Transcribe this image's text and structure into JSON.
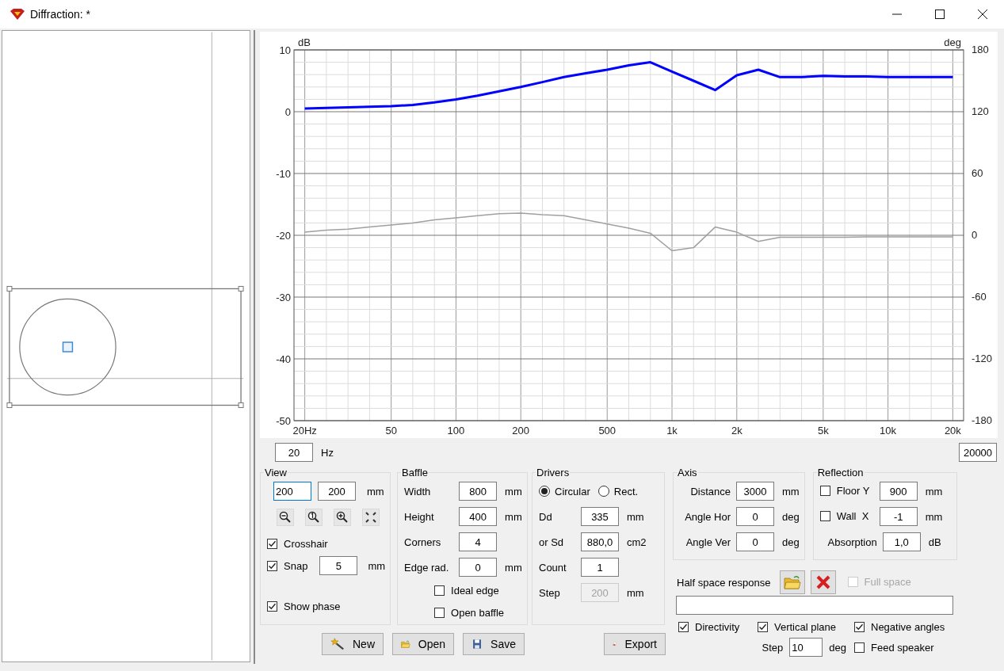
{
  "window": {
    "title": "Diffraction: *"
  },
  "chart": {
    "chart_data": {
      "type": "line",
      "categories": [
        "20Hz",
        null,
        null,
        null,
        "50",
        null,
        null,
        "100",
        null,
        null,
        "200",
        null,
        null,
        null,
        "500",
        null,
        null,
        "1k",
        null,
        null,
        "2k",
        null,
        null,
        null,
        "5k",
        null,
        null,
        "10k",
        null,
        null,
        "20k"
      ],
      "ylim": [
        -50,
        10
      ],
      "grid": true,
      "ylabel": "dB",
      "y2label": "deg",
      "y2lim": [
        -180,
        180
      ],
      "yticks": [
        10,
        0,
        -10,
        -20,
        -30,
        -40,
        -50
      ],
      "y2ticks": [
        180,
        120,
        60,
        0,
        -60,
        -120,
        -180
      ],
      "series": [
        {
          "color": "#0000ff",
          "values": [
            0.5,
            0.6,
            0.7,
            0.8,
            0.9,
            1.1,
            1.5,
            2.0,
            2.6,
            3.3,
            4.0,
            4.8,
            5.6,
            6.2,
            6.8,
            7.5,
            8.0,
            6.5,
            5.0,
            3.5,
            5.9,
            6.8,
            5.6,
            5.6,
            5.8,
            5.7,
            5.7,
            5.6,
            5.6,
            5.6,
            5.6
          ]
        },
        {
          "color": "#a0a0a0",
          "axis": "y2",
          "values": [
            3,
            5,
            6,
            8,
            10,
            12,
            15,
            17,
            19,
            21,
            21.5,
            20,
            19,
            15,
            11,
            7,
            2,
            -15,
            -12,
            8,
            3,
            -6,
            -2,
            -2,
            -2,
            -2,
            -1.5,
            -1.5,
            -1.5,
            -1.5,
            -1.5
          ]
        }
      ]
    }
  },
  "freq_range": {
    "min": "20",
    "unit": "Hz",
    "max": "20000"
  },
  "view": {
    "title": "View",
    "fields": [
      {
        "value": "200",
        "focused": true
      },
      {
        "value": "200",
        "focused": false
      }
    ],
    "unit": "mm",
    "crosshair": {
      "label": "Crosshair",
      "checked": true
    },
    "snap": {
      "label": "Snap",
      "checked": true,
      "value": "5",
      "unit": "mm"
    },
    "show_phase": {
      "label": "Show phase",
      "checked": true
    }
  },
  "baffle": {
    "title": "Baffle",
    "fields": [
      {
        "label": "Width",
        "value": "800",
        "unit": "mm"
      },
      {
        "label": "Height",
        "value": "400",
        "unit": "mm"
      },
      {
        "label": "Corners",
        "value": "4"
      },
      {
        "label": "Edge rad.",
        "value": "0",
        "unit": "mm"
      }
    ],
    "checks": [
      {
        "label": "Ideal edge",
        "checked": false
      },
      {
        "label": "Open baffle",
        "checked": false
      }
    ]
  },
  "file_buttons": [
    {
      "label": "New",
      "kind": "new"
    },
    {
      "label": "Open",
      "kind": "open"
    },
    {
      "label": "Save",
      "kind": "save"
    }
  ],
  "drivers": {
    "title": "Drivers",
    "shapes": [
      {
        "label": "Circular",
        "selected": true
      },
      {
        "label": "Rect.",
        "selected": false
      }
    ],
    "fields": [
      {
        "label": "Dd",
        "value": "335",
        "unit": "mm",
        "disabled": false
      },
      {
        "label": "or Sd",
        "value": "880,0",
        "unit": "cm2",
        "disabled": false
      },
      {
        "label": "Count",
        "value": "1",
        "disabled": false
      },
      {
        "label": "Step",
        "value": "200",
        "unit": "mm",
        "disabled": true
      }
    ]
  },
  "export_button": "Export",
  "axis": {
    "title": "Axis",
    "fields": [
      {
        "label": "Distance",
        "value": "3000",
        "unit": "mm"
      },
      {
        "label": "Angle Hor",
        "value": "0",
        "unit": "deg"
      },
      {
        "label": "Angle Ver",
        "value": "0",
        "unit": "deg"
      }
    ]
  },
  "reflection": {
    "title": "Reflection",
    "rows": [
      {
        "label": "Floor Y",
        "checked": false,
        "value": "900",
        "unit": "mm"
      },
      {
        "label": "Wall  X",
        "checked": false,
        "value": "-1",
        "unit": "mm"
      }
    ],
    "absorption": {
      "label": "Absorption",
      "value": "1,0",
      "unit": "dB"
    }
  },
  "half_space": {
    "label": "Half space response",
    "full_space": {
      "label": "Full space",
      "checked": false,
      "disabled": true
    }
  },
  "directivity": {
    "checks": [
      {
        "label": "Directivity",
        "checked": true
      },
      {
        "label": "Vertical plane",
        "checked": true
      },
      {
        "label": "Negative angles",
        "checked": true
      }
    ],
    "step": {
      "label": "Step",
      "value": "10",
      "unit": "deg"
    },
    "feed_speaker": {
      "label": "Feed speaker",
      "checked": false
    }
  }
}
